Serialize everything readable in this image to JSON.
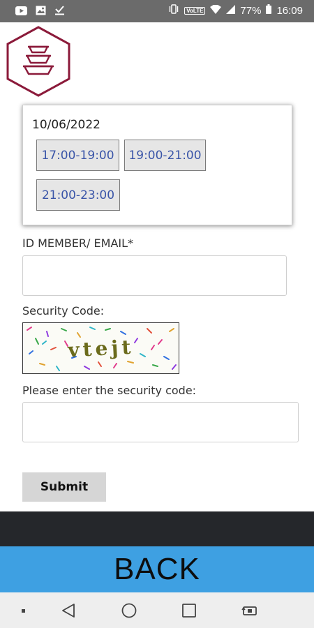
{
  "status_bar": {
    "icons_left": [
      "youtube-icon",
      "image-icon",
      "download-done-icon"
    ],
    "icons_right": [
      "vibrate-icon",
      "volte-icon",
      "wifi-icon",
      "signal-icon",
      "battery-icon"
    ],
    "volte": "VoLTE",
    "battery": "77%",
    "time": "16:09"
  },
  "logo": {
    "icon": "stacked-bowls-icon",
    "color": "#8b1a3a"
  },
  "booking": {
    "date": "10/06/2022",
    "slots": [
      "17:00-19:00",
      "19:00-21:00",
      "21:00-23:00"
    ]
  },
  "form": {
    "id_label": "ID MEMBER/ EMAIL*",
    "id_value": "",
    "security_label": "Security Code:",
    "captcha_text": "vtejt",
    "enter_code_label": "Please enter the security code:",
    "code_value": "",
    "submit": "Submit"
  },
  "back": {
    "label": "BACK",
    "color": "#3ea0e2"
  },
  "nav_bar": {
    "icons": [
      "dot-icon",
      "back-triangle-icon",
      "home-circle-icon",
      "recents-square-icon",
      "rotate-screen-icon"
    ]
  }
}
